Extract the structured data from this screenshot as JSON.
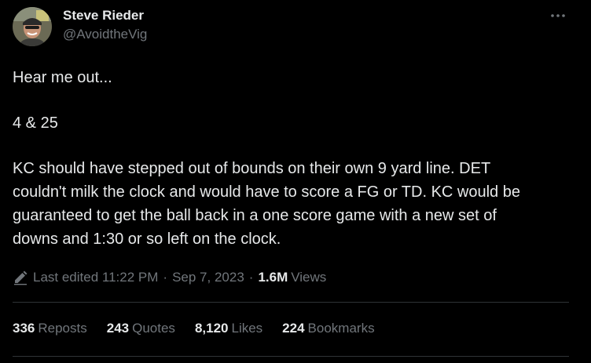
{
  "author": {
    "display_name": "Steve Rieder",
    "handle": "@AvoidtheVig"
  },
  "tweet": {
    "paragraphs": [
      "Hear me out...",
      "4 & 25",
      "KC should have stepped out of bounds on their own 9 yard line.  DET",
      "couldn't milk the clock and would have to score a FG or TD.  KC would be",
      "guaranteed to get the ball back in a one score game with a new set of",
      "downs and 1:30 or so left on the clock."
    ]
  },
  "meta": {
    "edited": "Last edited 11:22 PM",
    "date": "Sep 7, 2023",
    "views_count": "1.6M",
    "views_label": "Views",
    "separator": "·"
  },
  "stats": {
    "reposts": {
      "count": "336",
      "label": "Reposts"
    },
    "quotes": {
      "count": "243",
      "label": "Quotes"
    },
    "likes": {
      "count": "8,120",
      "label": "Likes"
    },
    "bookmarks": {
      "count": "224",
      "label": "Bookmarks"
    }
  },
  "icons": {
    "more": "more-horizontal-icon",
    "edit": "pencil-icon"
  },
  "colors": {
    "background": "#000000",
    "text_primary": "#e7e9ea",
    "text_secondary": "#71767b",
    "divider": "#2f3336"
  }
}
